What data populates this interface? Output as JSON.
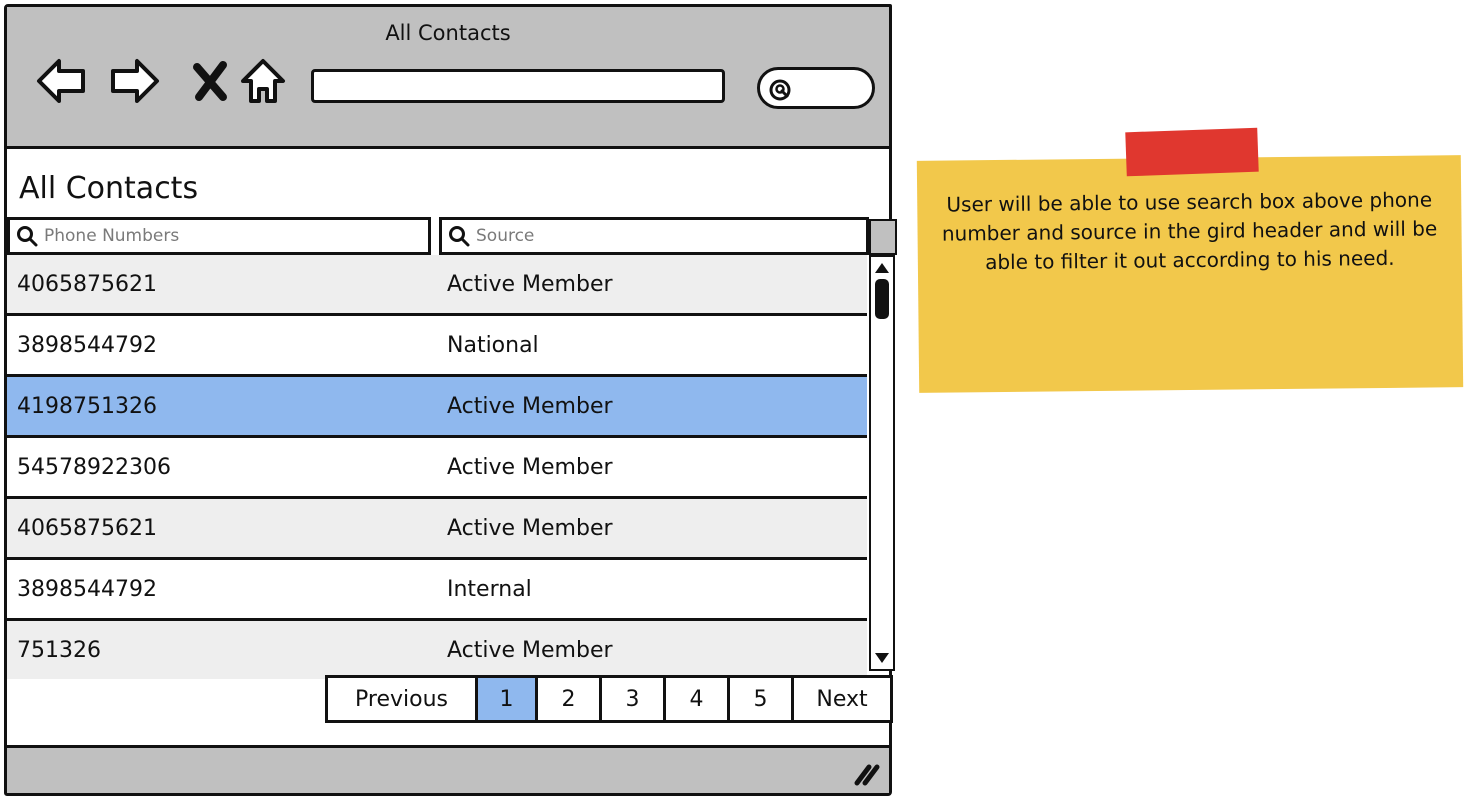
{
  "window": {
    "title": "All Contacts",
    "address_value": ""
  },
  "page": {
    "title": "All Contacts"
  },
  "grid": {
    "filters": {
      "phone_placeholder": "Phone Numbers",
      "source_placeholder": "Source"
    },
    "rows": [
      {
        "phone": "4065875621",
        "source": "Active Member",
        "selected": false
      },
      {
        "phone": "3898544792",
        "source": "National",
        "selected": false
      },
      {
        "phone": "4198751326",
        "source": "Active Member",
        "selected": true
      },
      {
        "phone": "54578922306",
        "source": "Active Member",
        "selected": false
      },
      {
        "phone": "4065875621",
        "source": "Active Member",
        "selected": false
      },
      {
        "phone": "3898544792",
        "source": "Internal",
        "selected": false
      },
      {
        "phone": "751326",
        "source": "Active Member",
        "selected": false
      }
    ]
  },
  "pagination": {
    "previous_label": "Previous",
    "pages": [
      "1",
      "2",
      "3",
      "4",
      "5"
    ],
    "active_page": "1",
    "next_label": "Next"
  },
  "note": {
    "text": "User will be able to use search box above phone number and source in the gird header and will be able to filter it out according to his need."
  },
  "icons": {
    "back": "arrow-left-icon",
    "forward": "arrow-right-icon",
    "stop": "close-icon",
    "home": "home-icon",
    "search": "search-icon",
    "resize": "resize-grip-icon"
  },
  "colors": {
    "chrome": "#c0c0c0",
    "selected_row": "#8fb8ee",
    "alt_row": "#eeeeee",
    "note": "#f2c84b",
    "tape": "#e0372f"
  }
}
